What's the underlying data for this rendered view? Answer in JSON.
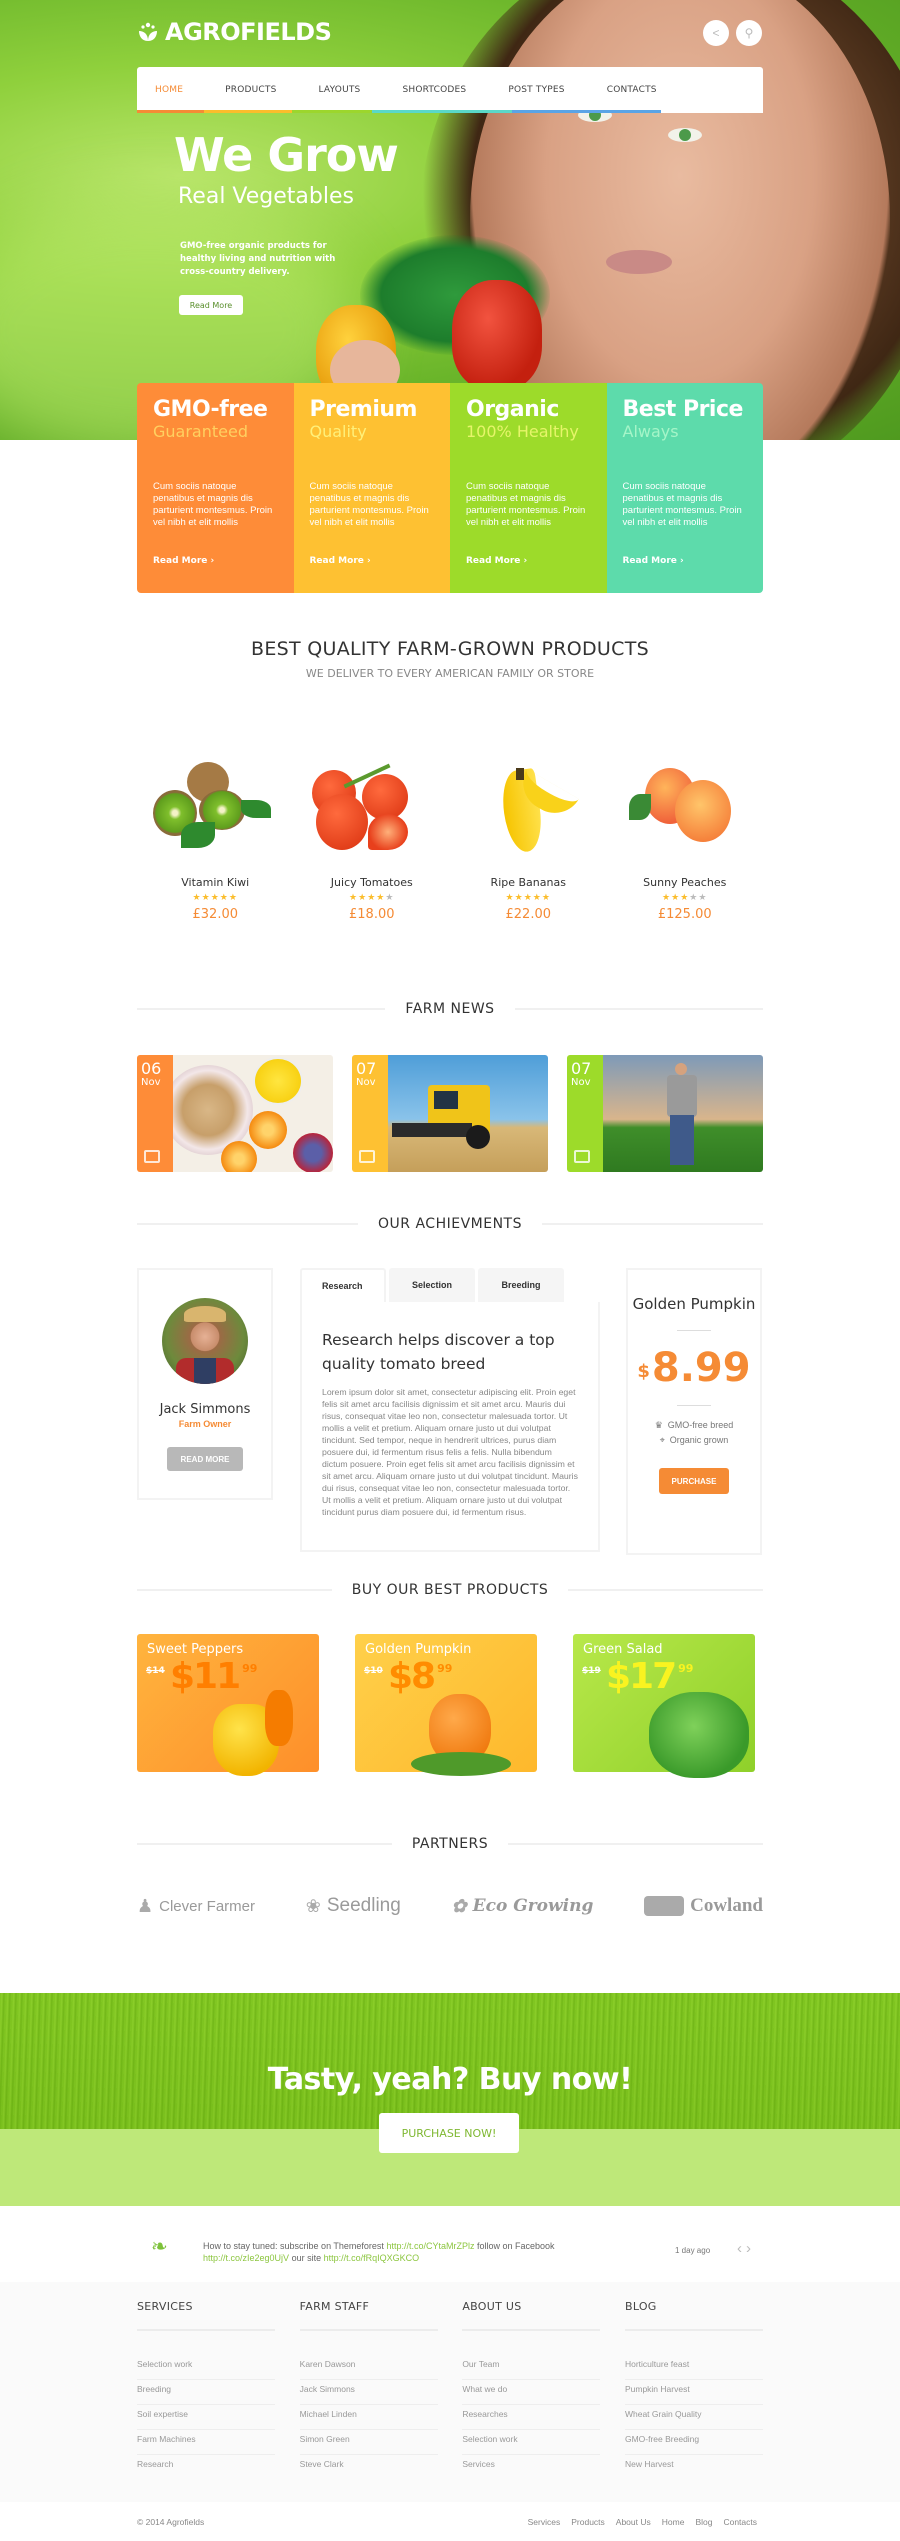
{
  "brand": {
    "name": "AGROFIELDS",
    "logo_icon": "leaf-sprout-icon"
  },
  "header": {
    "share_icon": "share-icon",
    "search_icon": "search-icon",
    "nav": [
      {
        "label": "HOME",
        "active": true
      },
      {
        "label": "PRODUCTS"
      },
      {
        "label": "LAYOUTS"
      },
      {
        "label": "SHORTCODES"
      },
      {
        "label": "POST TYPES"
      },
      {
        "label": "CONTACTS"
      }
    ],
    "nav_stripe_colors": [
      "#f58b35",
      "#fbbd2b",
      "#9cd62d",
      "#5ad8a8",
      "#5ab4e6"
    ]
  },
  "hero": {
    "title": "We Grow",
    "subtitle": "Real Vegetables",
    "description": "GMO-free organic products for healthy living and nutrition with cross-country delivery.",
    "button": "Read More"
  },
  "features": [
    {
      "title": "GMO-free",
      "subtitle": "Guaranteed",
      "body": "Cum sociis natoque penatibus et magnis dis parturient montesmus. Proin vel nibh et elit mollis",
      "link": "Read More",
      "color": "#fe8c38",
      "sub_color": "#ffd060"
    },
    {
      "title": "Premium",
      "subtitle": "Quality",
      "body": "Cum sociis natoque penatibus et magnis dis parturient montesmus. Proin vel nibh et elit mollis",
      "link": "Read More",
      "color": "#fec132",
      "sub_color": "#fff07a"
    },
    {
      "title": "Organic",
      "subtitle": "100% Healthy",
      "body": "Cum sociis natoque penatibus et magnis dis parturient montesmus. Proin vel nibh et elit mollis",
      "link": "Read More",
      "color": "#9ddb2a",
      "sub_color": "#e6f56a"
    },
    {
      "title": "Best Price",
      "subtitle": "Always",
      "body": "Cum sociis natoque penatibus et magnis dis parturient montesmus. Proin vel nibh et elit mollis",
      "link": "Read More",
      "color": "#5ddbab",
      "sub_color": "#a5f5c8"
    }
  ],
  "products_section": {
    "title": "BEST QUALITY FARM-GROWN PRODUCTS",
    "subtitle": "WE DELIVER TO EVERY AMERICAN FAMILY OR STORE",
    "items": [
      {
        "name": "Vitamin Kiwi",
        "rating": 5,
        "price": "£32.00"
      },
      {
        "name": "Juicy Tomatoes",
        "rating": 4,
        "price": "£18.00"
      },
      {
        "name": "Ripe Bananas",
        "rating": 4.5,
        "price": "£22.00"
      },
      {
        "name": "Sunny Peaches",
        "rating": 3,
        "price": "£125.00"
      }
    ]
  },
  "news": {
    "title": "FARM NEWS",
    "items": [
      {
        "day": "06",
        "month": "Nov",
        "color": "#fe8c38",
        "icon": "monitor-icon"
      },
      {
        "day": "07",
        "month": "Nov",
        "color": "#fec132",
        "icon": "monitor-icon"
      },
      {
        "day": "07",
        "month": "Nov",
        "color": "#9ddb2a",
        "icon": "monitor-icon"
      }
    ]
  },
  "achievements": {
    "title": "OUR ACHIEVMENTS",
    "profile": {
      "name": "Jack Simmons",
      "role": "Farm Owner",
      "button": "READ MORE"
    },
    "tabs": [
      {
        "label": "Research",
        "active": true
      },
      {
        "label": "Selection"
      },
      {
        "label": "Breeding"
      }
    ],
    "panel": {
      "heading": "Research helps discover a top quality tomato breed",
      "body": "Lorem ipsum dolor sit amet, consectetur adipiscing elit. Proin eget felis sit amet arcu facilisis dignissim et sit amet arcu. Mauris dui risus, consequat vitae leo non, consectetur malesuada tortor. Ut mollis a velit et pretium. Aliquam ornare justo ut dui volutpat tincidunt. Sed tempor, neque in hendrerit ultrices, purus diam posuere dui, id fermentum risus felis a felis. Nulla bibendum dictum posuere. Proin eget felis sit amet arcu facilisis dignissim et sit amet arcu. Aliquam ornare justo ut dui volutpat tincidunt. Mauris dui risus, consequat vitae leo non, consectetur malesuada tortor. Ut mollis a velit et pretium. Aliquam ornare justo ut dui volutpat tincidunt purus diam posuere dui, id fermentum risus."
    },
    "pricing": {
      "title": "Golden Pumpkin",
      "currency": "$",
      "amount": "8.99",
      "features": [
        {
          "icon": "award-icon",
          "label": "GMO-free breed"
        },
        {
          "icon": "sprout-icon",
          "label": "Organic grown"
        }
      ],
      "button": "PURCHASE"
    }
  },
  "best_products": {
    "title": "BUY OUR BEST PRODUCTS",
    "items": [
      {
        "name": "Sweet Peppers",
        "old_price": "$14",
        "price": "$11",
        "cents": "99",
        "bg": "#fea42f",
        "price_color": "#ff8a00"
      },
      {
        "name": "Golden Pumpkin",
        "old_price": "$10",
        "price": "$8",
        "cents": "99",
        "bg": "#fec53a",
        "price_color": "#ff9a00"
      },
      {
        "name": "Green Salad",
        "old_price": "$19",
        "price": "$17",
        "cents": "99",
        "bg": "#9fdc35",
        "price_color": "#f9f320"
      }
    ]
  },
  "partners": {
    "title": "PARTNERS",
    "items": [
      {
        "name": "Clever Farmer",
        "icon": "farmer-icon"
      },
      {
        "name": "Seedling",
        "icon": "wheat-icon"
      },
      {
        "name": "Eco Growing",
        "icon": "watering-sprout-icon"
      },
      {
        "name": "Cowland",
        "icon": "cow-icon"
      }
    ]
  },
  "cta": {
    "title": "Tasty, yeah? Buy now!",
    "button": "PURCHASE NOW!"
  },
  "tweet": {
    "text_1": "How to stay tuned: subscribe on Themeforest ",
    "link_1": "http://t.co/CYtaMrZPlz",
    "text_2": " follow on Facebook ",
    "link_2": "http://t.co/zIe2eg0UjV",
    "text_3": " our site ",
    "link_3": "http://t.co/fRqIQXGKCO",
    "time": "1 day ago"
  },
  "footer": {
    "columns": [
      {
        "title": "SERVICES",
        "links": [
          "Selection work",
          "Breeding",
          "Soil expertise",
          "Farm Machines",
          "Research"
        ]
      },
      {
        "title": "FARM STAFF",
        "links": [
          "Karen Dawson",
          "Jack Simmons",
          "Michael Linden",
          "Simon Green",
          "Steve Clark"
        ]
      },
      {
        "title": "ABOUT US",
        "links": [
          "Our Team",
          "What we do",
          "Researches",
          "Selection work",
          "Services"
        ]
      },
      {
        "title": "BLOG",
        "links": [
          "Horticulture feast",
          "Pumpkin Harvest",
          "Wheat Grain Quality",
          "GMO-free Breeding",
          "New Harvest"
        ]
      }
    ],
    "copyright": "© 2014 Agrofields",
    "bottom_links": [
      "Services",
      "Products",
      "About Us",
      "Home",
      "Blog",
      "Contacts"
    ]
  }
}
